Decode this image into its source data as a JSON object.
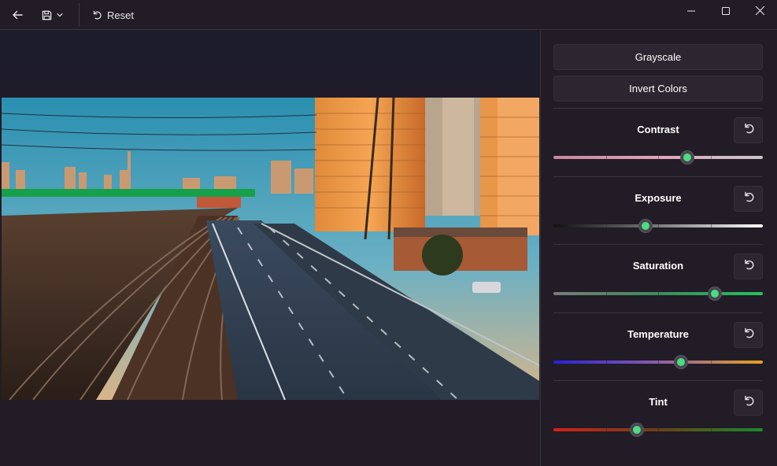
{
  "toolbar": {
    "back_icon": "arrow-left-icon",
    "save_icon": "save-icon",
    "save_dropdown_icon": "chevron-down-icon",
    "reset_icon": "undo-icon",
    "reset_label": "Reset"
  },
  "window": {
    "minimize_icon": "minimize-icon",
    "maximize_icon": "maximize-icon",
    "close_icon": "close-icon"
  },
  "panel": {
    "grayscale_label": "Grayscale",
    "invert_label": "Invert Colors",
    "sliders": [
      {
        "label": "Contrast",
        "value": 0.64,
        "colors": [
          "#c8869e",
          "#e3a3bb",
          "#c8c6ca"
        ]
      },
      {
        "label": "Exposure",
        "value": 0.44,
        "colors": [
          "#111111",
          "#7a7a7a",
          "#ffffff"
        ]
      },
      {
        "label": "Saturation",
        "value": 0.77,
        "colors": [
          "#7a7a7a",
          "#3c8c5c",
          "#24c060"
        ]
      },
      {
        "label": "Temperature",
        "value": 0.61,
        "colors": [
          "#2a20d8",
          "#8a60a8",
          "#e8a020"
        ]
      },
      {
        "label": "Tint",
        "value": 0.4,
        "colors": [
          "#d42018",
          "#6a4018",
          "#1a8a2a"
        ]
      }
    ],
    "undo_icon": "undo-icon"
  },
  "colors": {
    "accent": "#4ade80",
    "background": "#1e1a22",
    "panel": "#221c26"
  }
}
